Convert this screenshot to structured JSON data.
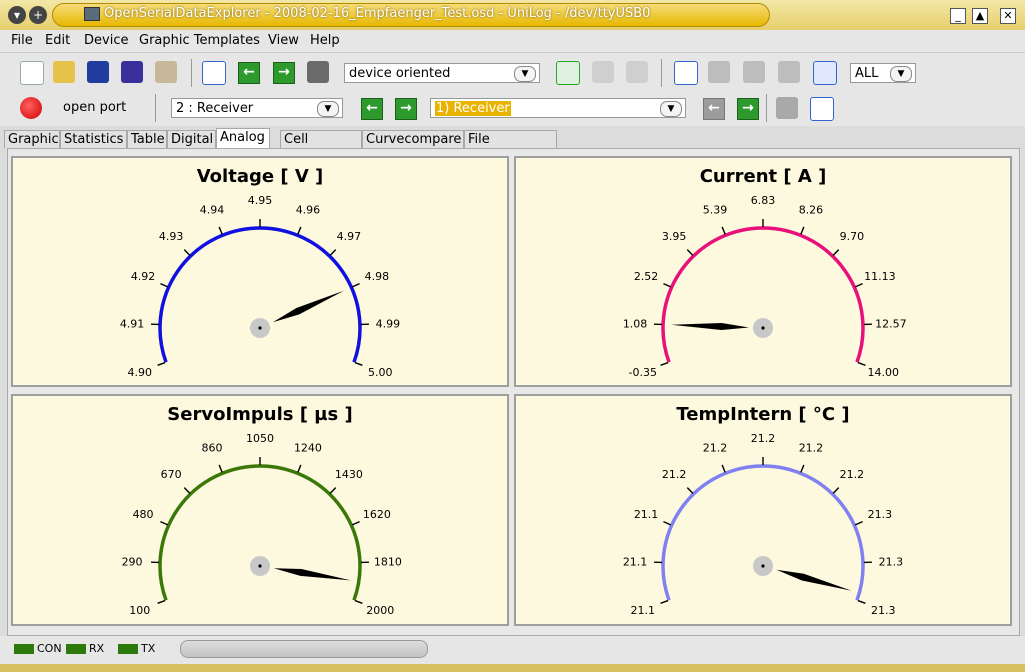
{
  "window": {
    "title": "OpenSerialDataExplorer  -  2008-02-16_Empfaenger_Test.osd  -  UniLog  -  /dev/ttyUSB0"
  },
  "menu": [
    "File",
    "Edit",
    "Device",
    "Graphic Templates",
    "View",
    "Help"
  ],
  "toolbar": {
    "view_mode": "device oriented",
    "scope": "ALL"
  },
  "toolbar2": {
    "port_label": "open port",
    "channel": "2 : Receiver",
    "record": "1) Receiver"
  },
  "tabs": [
    "Graphic",
    "Statistics",
    "Table",
    "Digital",
    "Analog",
    "Cell voltage",
    "Curvecompare",
    "File comment"
  ],
  "active_tab": "Analog",
  "gauges": [
    {
      "title": "Voltage [ V ]",
      "color": "#1010e0",
      "labels": [
        "4.90",
        "4.91",
        "4.92",
        "4.93",
        "4.94",
        "4.95",
        "4.96",
        "4.97",
        "4.98",
        "4.99",
        "5.00"
      ],
      "value_fraction": 0.8
    },
    {
      "title": "Current [ A ]",
      "color": "#e8107a",
      "labels": [
        "-0.35",
        "1.08",
        "2.52",
        "3.95",
        "5.39",
        "6.83",
        "8.26",
        "9.70",
        "11.13",
        "12.57",
        "14.00"
      ],
      "value_fraction": 0.1
    },
    {
      "title": "ServoImpuls [ µs ]",
      "color": "#3a7808",
      "labels": [
        "100",
        "290",
        "480",
        "670",
        "860",
        "1050",
        "1240",
        "1430",
        "1620",
        "1810",
        "2000"
      ],
      "value_fraction": 0.95
    },
    {
      "title": "TempIntern [ °C ]",
      "color": "#8080f0",
      "labels": [
        "21.1",
        "21.1",
        "21.1",
        "21.2",
        "21.2",
        "21.2",
        "21.2",
        "21.2",
        "21.3",
        "21.3",
        "21.3"
      ],
      "value_fraction": 0.98
    }
  ],
  "status": {
    "leds": [
      "CON",
      "RX",
      "TX"
    ],
    "led_color": "#2b7a0b"
  }
}
